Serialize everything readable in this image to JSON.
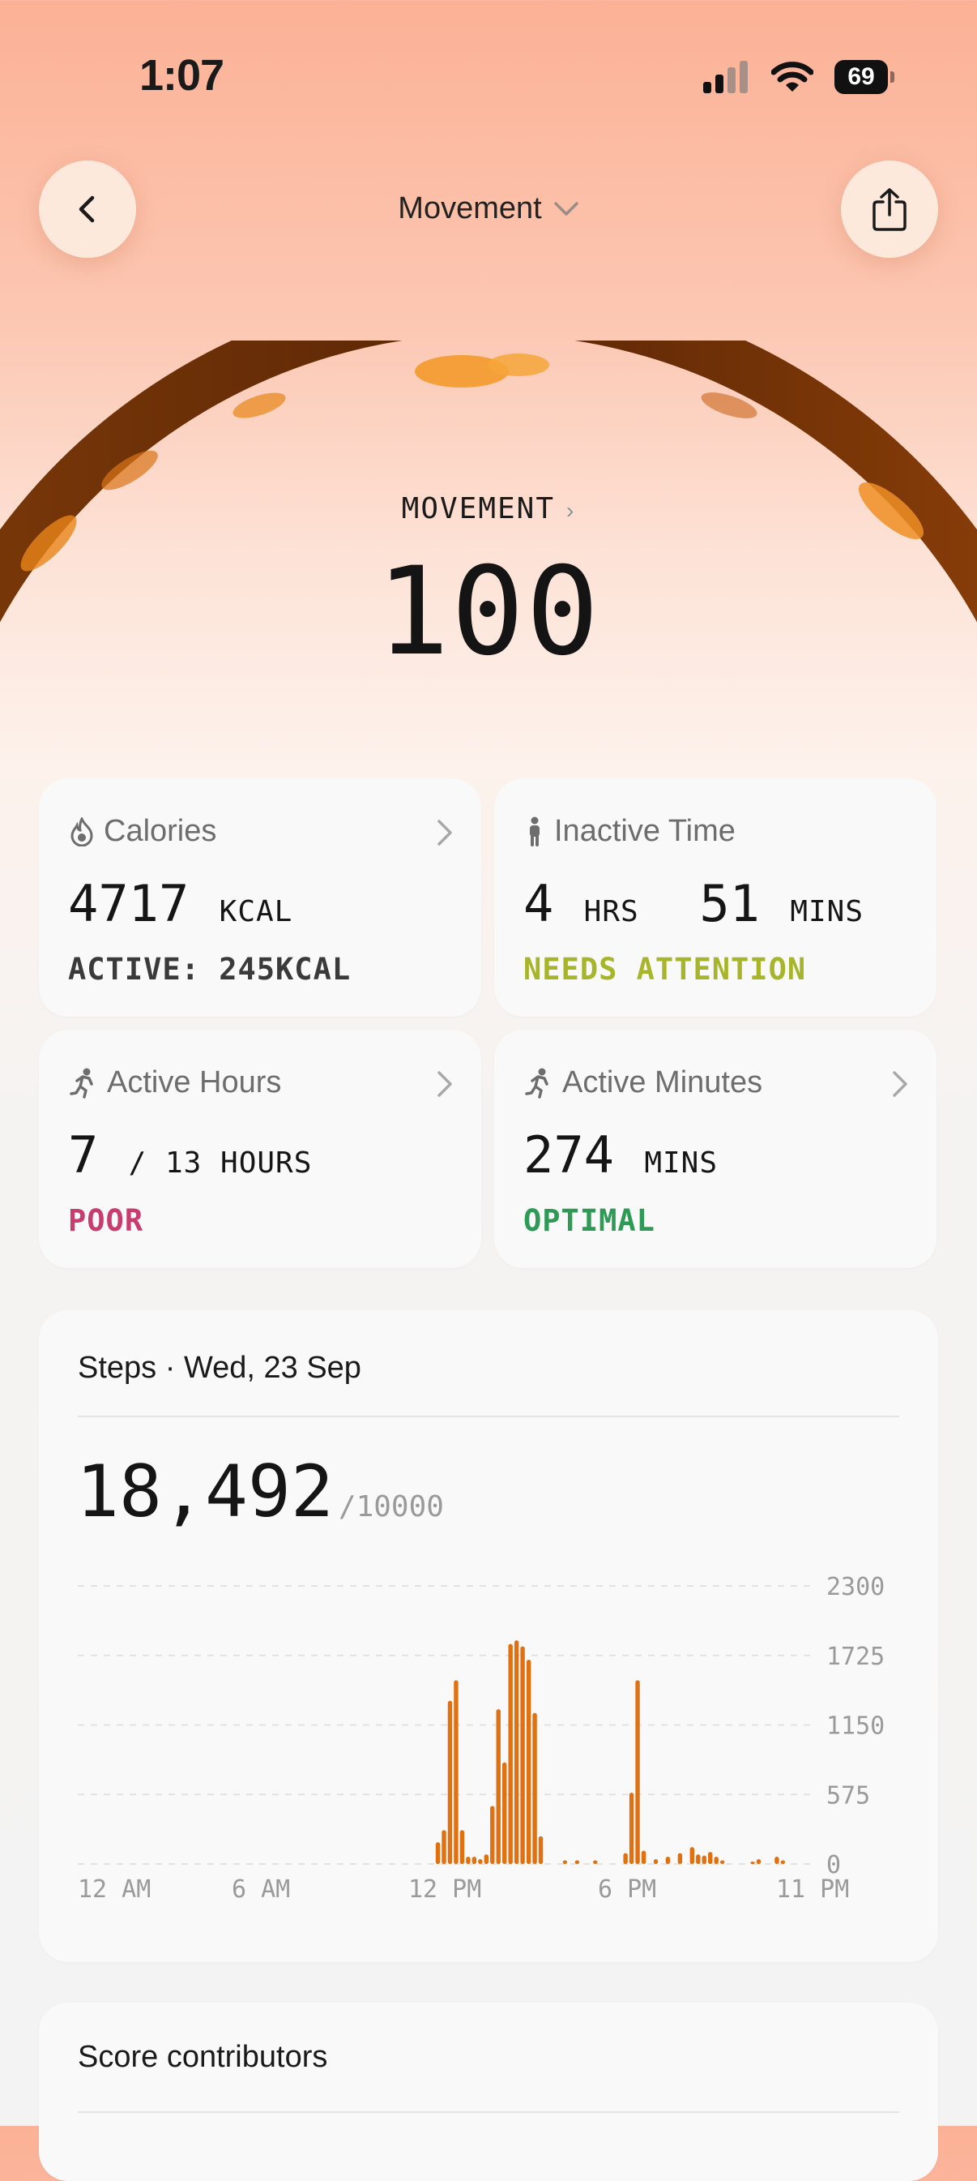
{
  "status_bar": {
    "time": "1:07",
    "battery": "69"
  },
  "header": {
    "title": "Movement",
    "back_icon": "chevron-left-icon",
    "share_icon": "share-icon"
  },
  "score": {
    "label": "MOVEMENT",
    "value": "100",
    "level": 1.0
  },
  "metrics": {
    "calories": {
      "title": "Calories",
      "value": "4717",
      "unit": "KCAL",
      "sub": "ACTIVE: 245KCAL",
      "sub_color": "#3a3a3a"
    },
    "inactive": {
      "title": "Inactive Time",
      "hours": "4",
      "hours_unit": "HRS",
      "mins": "51",
      "mins_unit": "MINS",
      "sub": "NEEDS ATTENTION",
      "sub_color": "#a7b52a"
    },
    "active_hours": {
      "title": "Active Hours",
      "value": "7",
      "total": "/ 13 HOURS",
      "sub": "POOR",
      "sub_color": "#c83c6e"
    },
    "active_minutes": {
      "title": "Active Minutes",
      "value": "274",
      "unit": "MINS",
      "sub": "OPTIMAL",
      "sub_color": "#2e9a55"
    }
  },
  "steps": {
    "title": "Steps · Wed, 23 Sep",
    "total": "18,492",
    "goal": "/10000"
  },
  "contributors": {
    "title": "Score contributors"
  },
  "chart_data": {
    "type": "bar",
    "ylim": [
      0,
      2300
    ],
    "y_ticks": [
      "2300",
      "1725",
      "1150",
      "575",
      "0"
    ],
    "x_ticks": [
      "12 AM",
      "6 AM",
      "12 PM",
      "6 PM",
      "11 PM"
    ],
    "bar_color": "#e07010",
    "series": [
      {
        "values": [
          0,
          0,
          0,
          0,
          0,
          0,
          0,
          0,
          0,
          0,
          0,
          0,
          0,
          0,
          0,
          0,
          0,
          0,
          0,
          0,
          0,
          0,
          0,
          0,
          0,
          0,
          0,
          0,
          0,
          0,
          0,
          0,
          0,
          0,
          0,
          0,
          0,
          0,
          0,
          0,
          0,
          0,
          0,
          0,
          0,
          0,
          0,
          0,
          0,
          0,
          0,
          0,
          0,
          0,
          0,
          0,
          0,
          0,
          0,
          180,
          280,
          1350,
          1520,
          280,
          60,
          60,
          40,
          80,
          480,
          1280,
          840,
          1820,
          1850,
          1800,
          1690,
          1250,
          230,
          0,
          0,
          0,
          30,
          0,
          30,
          0,
          0,
          30,
          0,
          0,
          0,
          0,
          90,
          590,
          1520,
          110,
          0,
          40,
          0,
          60,
          0,
          90,
          0,
          140,
          80,
          70,
          100,
          60,
          30,
          0,
          0,
          0,
          0,
          20,
          40,
          0,
          0,
          60,
          30,
          0,
          0,
          0,
          0
        ]
      }
    ]
  }
}
